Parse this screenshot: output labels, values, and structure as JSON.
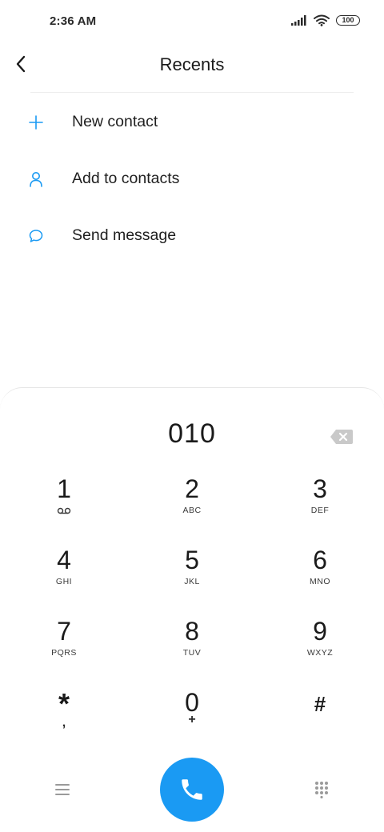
{
  "status_bar": {
    "time": "2:36 AM",
    "battery": "100"
  },
  "header": {
    "title": "Recents"
  },
  "actions": [
    {
      "label": "New contact",
      "icon": "plus-icon"
    },
    {
      "label": "Add to contacts",
      "icon": "person-icon"
    },
    {
      "label": "Send message",
      "icon": "message-icon"
    }
  ],
  "dialpad": {
    "number": "010",
    "keys": [
      {
        "digit": "1",
        "letters": ""
      },
      {
        "digit": "2",
        "letters": "ABC"
      },
      {
        "digit": "3",
        "letters": "DEF"
      },
      {
        "digit": "4",
        "letters": "GHI"
      },
      {
        "digit": "5",
        "letters": "JKL"
      },
      {
        "digit": "6",
        "letters": "MNO"
      },
      {
        "digit": "7",
        "letters": "PQRS"
      },
      {
        "digit": "8",
        "letters": "TUV"
      },
      {
        "digit": "9",
        "letters": "WXYZ"
      },
      {
        "digit": "*",
        "letters": ","
      },
      {
        "digit": "0",
        "letters": "+"
      },
      {
        "digit": "#",
        "letters": ""
      }
    ]
  },
  "colors": {
    "accent": "#1a9af3",
    "text": "#1f1f1f"
  }
}
